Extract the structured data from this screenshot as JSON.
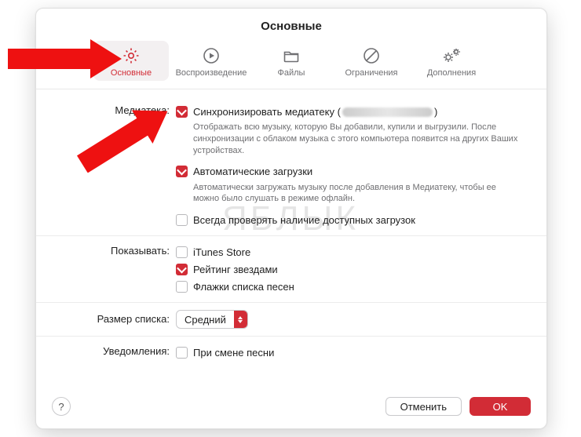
{
  "title": "Основные",
  "tabs": [
    {
      "label": "Основные"
    },
    {
      "label": "Воспроизведение"
    },
    {
      "label": "Файлы"
    },
    {
      "label": "Ограничения"
    },
    {
      "label": "Дополнения"
    }
  ],
  "section_labels": {
    "library": "Медиатека:",
    "show": "Показывать:",
    "list_size": "Размер списка:",
    "notifications": "Уведомления:"
  },
  "library": {
    "sync_label_prefix": "Синхронизировать медиатеку (",
    "sync_label_suffix": ")",
    "sync_desc": "Отображать всю музыку, которую Вы добавили, купили и выгрузили. После синхронизации с облаком музыка с этого компьютера появится на других Ваших устройствах.",
    "auto_dl_label": "Автоматические загрузки",
    "auto_dl_desc": "Автоматически загружать музыку после добавления в Медиатеку, чтобы ее можно было слушать в режиме офлайн.",
    "always_check_label": "Всегда проверять наличие доступных загрузок"
  },
  "show": {
    "itunes_store": "iTunes Store",
    "star_ratings": "Рейтинг звездами",
    "song_flags": "Флажки списка песен"
  },
  "list_size": {
    "value": "Средний"
  },
  "notifications": {
    "on_song_change": "При смене песни"
  },
  "buttons": {
    "help": "?",
    "cancel": "Отменить",
    "ok": "OK"
  },
  "watermark": "ЯБЛЫК",
  "colors": {
    "accent": "#d22c36"
  }
}
